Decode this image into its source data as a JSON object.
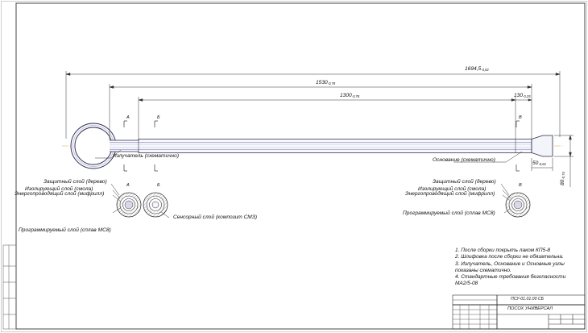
{
  "drawing": {
    "dimensions": {
      "overall": {
        "value": "1694,5",
        "tolerance": "-0,92"
      },
      "length_1530": {
        "value": "1530",
        "tolerance": "-0,78"
      },
      "length_1300": {
        "value": "1300",
        "tolerance": "-0,78"
      },
      "length_130": {
        "value": "130",
        "tolerance": "-0,25"
      },
      "length_50": {
        "value": "50",
        "tolerance": "-0,62"
      },
      "diameter_80": {
        "value": "80",
        "tolerance": "-0,74"
      }
    },
    "section_marks": {
      "a": "А",
      "b": "Б",
      "v": "В"
    },
    "callouts": {
      "emitter": "Излучатель (схематично)",
      "base": "Основание (схематично)",
      "left_protective": "Защитный слой (дерево)",
      "left_insulating": "Изолирующий слой (смола)",
      "left_conductive": "Энергопроводящий слой (мифрилл)",
      "left_programmable": "Программируемый слой (сплав МС8)",
      "sensor": "Сенсорный слой (композит СМЗ)",
      "right_protective": "Защитный слой (дерево)",
      "right_insulating": "Изолирующий слой (смола)",
      "right_conductive": "Энергопроводящий слой (мифрилл)",
      "right_programmable": "Программируемый слой (сплав МС8)"
    },
    "notes": [
      "1. После сборки покрыть лаком КП5-8",
      "2. Шлифовка после сборки не обязательна.",
      "3. Излучатель, Основание и Основные узлы",
      "показаны схематично.",
      "4. Стандартные требования безопасности",
      "МА2/5-08"
    ],
    "title_block": {
      "designation": "ПСУ-01.01.00 СБ",
      "name": "ПОСОХ УНИВЕРСАЛ"
    }
  }
}
